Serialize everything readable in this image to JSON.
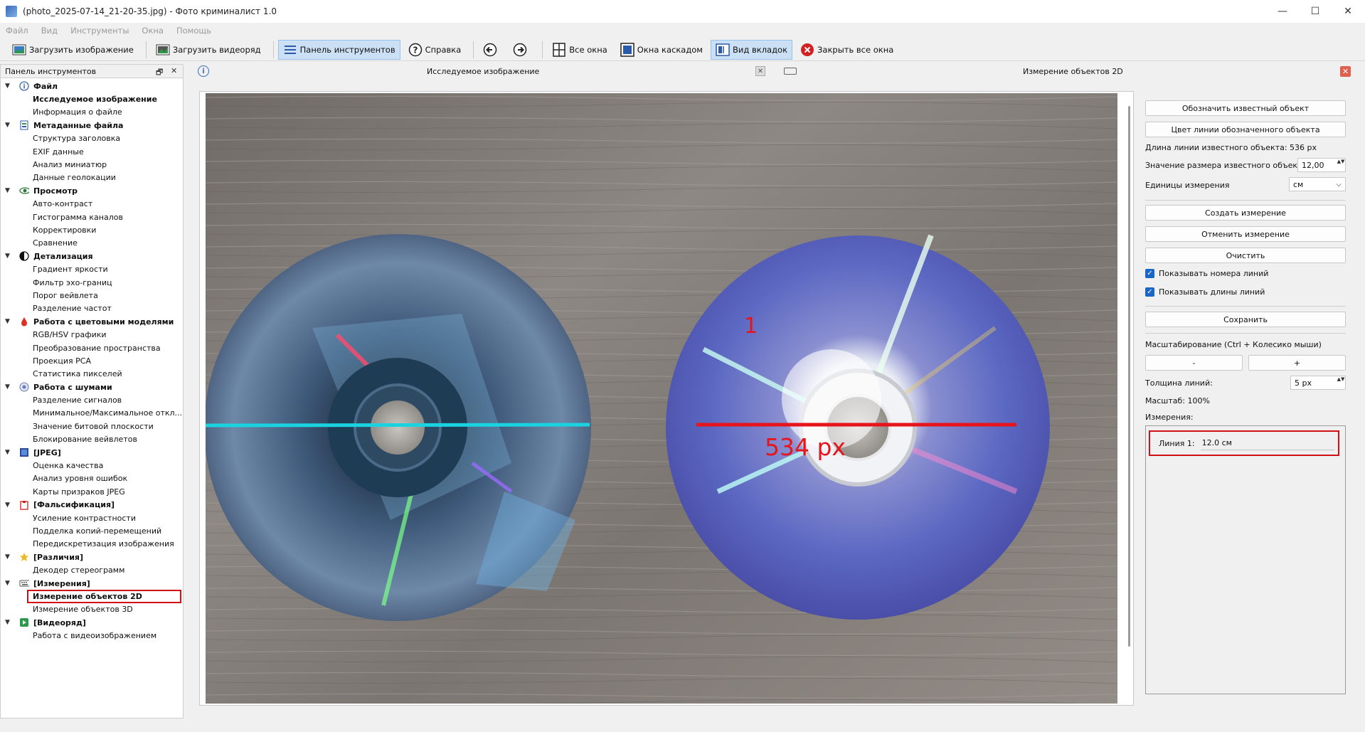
{
  "window": {
    "title": "(photo_2025-07-14_21-20-35.jpg) - Фото криминалист 1.0",
    "controls": {
      "minimize": "—",
      "maximize": "☐",
      "close": "✕"
    }
  },
  "menu": [
    "Файл",
    "Вид",
    "Инструменты",
    "Окна",
    "Помощь"
  ],
  "toolbar": {
    "load_image": "Загрузить изображение",
    "load_video": "Загрузить видеоряд",
    "tools_panel": "Панель инструментов",
    "help": "Справка",
    "all_windows": "Все окна",
    "cascade": "Окна каскадом",
    "tab_view": "Вид вкладок",
    "close_all": "Закрыть все окна"
  },
  "left_panel": {
    "title": "Панель инструментов",
    "float_glyph": "🗗",
    "close_glyph": "✕",
    "chevron": "▼",
    "groups": [
      {
        "label": "Файл",
        "icon": "info-icon",
        "items": [
          "Исследуемое изображение",
          "Информация о файле"
        ],
        "bold_index": 0
      },
      {
        "label": "Метаданные файла",
        "icon": "metadata-icon",
        "items": [
          "Структура заголовка",
          "EXIF данные",
          "Анализ миниатюр",
          "Данные геолокации"
        ]
      },
      {
        "label": "Просмотр",
        "icon": "eye-icon",
        "items": [
          "Авто-контраст",
          "Гистограмма каналов",
          "Корректировки",
          "Сравнение"
        ]
      },
      {
        "label": "Детализация",
        "icon": "contrast-icon",
        "items": [
          "Градиент яркости",
          "Фильтр эхо-границ",
          "Порог вейвлета",
          "Разделение частот"
        ]
      },
      {
        "label": "Работа с цветовыми моделями",
        "icon": "drop-icon",
        "items": [
          "RGB/HSV графики",
          "Преобразование пространства",
          "Проекция PCA",
          "Статистика пикселей"
        ]
      },
      {
        "label": "Работа с шумами",
        "icon": "noise-icon",
        "items": [
          "Разделение сигналов",
          "Минимальное/Максимальное откл...",
          "Значение битовой плоскости",
          "Блокирование вейвлетов"
        ]
      },
      {
        "label": "[JPEG]",
        "icon": "jpeg-icon",
        "items": [
          "Оценка качества",
          "Анализ уровня ошибок",
          "Карты призраков JPEG"
        ]
      },
      {
        "label": "[Фальсификация]",
        "icon": "clipboard-icon",
        "items": [
          "Усиление контрастности",
          "Подделка копий-перемещений",
          "Передискретизация изображения"
        ]
      },
      {
        "label": "[Различия]",
        "icon": "star-icon",
        "items": [
          "Декодер стереограмм"
        ]
      },
      {
        "label": "[Измерения]",
        "icon": "keyboard-icon",
        "items": [
          "Измерение объектов 2D",
          "Измерение объектов 3D"
        ],
        "selected_index": 0
      },
      {
        "label": "[Видеоряд]",
        "icon": "play-icon",
        "items": [
          "Работа с видеоизображением"
        ]
      }
    ]
  },
  "image_window": {
    "title": "Исследуемое изображение",
    "info_glyph": "i",
    "close_glyph": "✕"
  },
  "measure_window": {
    "title": "Измерение объектов 2D",
    "close_glyph": "✕"
  },
  "photo": {
    "line_number": "1",
    "line_label": "534 px",
    "reference_line_color": "#19d3e0",
    "measure_line_color": "#e8141b"
  },
  "measure_panel": {
    "mark_known": "Обозначить известный объект",
    "line_color": "Цвет линии обозначенного объекта",
    "known_length": "Длина линии известного объекта: 536 px",
    "known_size_label": "Значение размера известного объекта",
    "known_size_value": "12,00",
    "units_label": "Единицы измерения",
    "units_value": "см",
    "create": "Создать измерение",
    "undo": "Отменить измерение",
    "clear": "Очистить",
    "show_numbers": "Показывать номера линий",
    "show_lengths": "Показывать длины линий",
    "check_glyph": "✓",
    "save": "Сохранить",
    "zoom_label": "Масштабирование (Ctrl + Колесико мыши)",
    "zoom_minus": "-",
    "zoom_plus": "+",
    "thickness_label": "Толщина линий:",
    "thickness_value": "5 px",
    "scale": "Масштаб: 100%",
    "measurements_label": "Измерения:",
    "result_label": "Линия 1:",
    "result_value": "12.0 см",
    "spin_arrows": "▲▼",
    "dropdown_glyph": "⌵"
  }
}
